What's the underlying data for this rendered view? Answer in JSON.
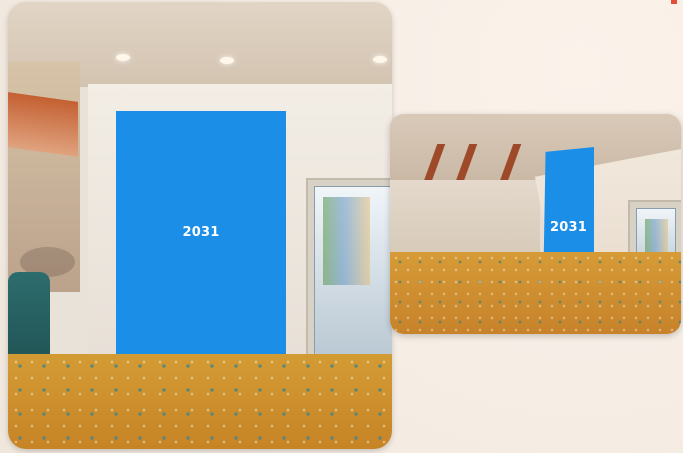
{
  "image": {
    "width": 683,
    "height": 453
  },
  "photos": {
    "main": {
      "screen_label": "2031",
      "screen_color": "#1b8ee8"
    },
    "secondary": {
      "screen_label": "2031",
      "screen_color": "#1b8ee8"
    }
  },
  "colors": {
    "background": "#f7efe6",
    "carpet_gold": "#d39b34",
    "accent_red": "#e64d3b"
  }
}
